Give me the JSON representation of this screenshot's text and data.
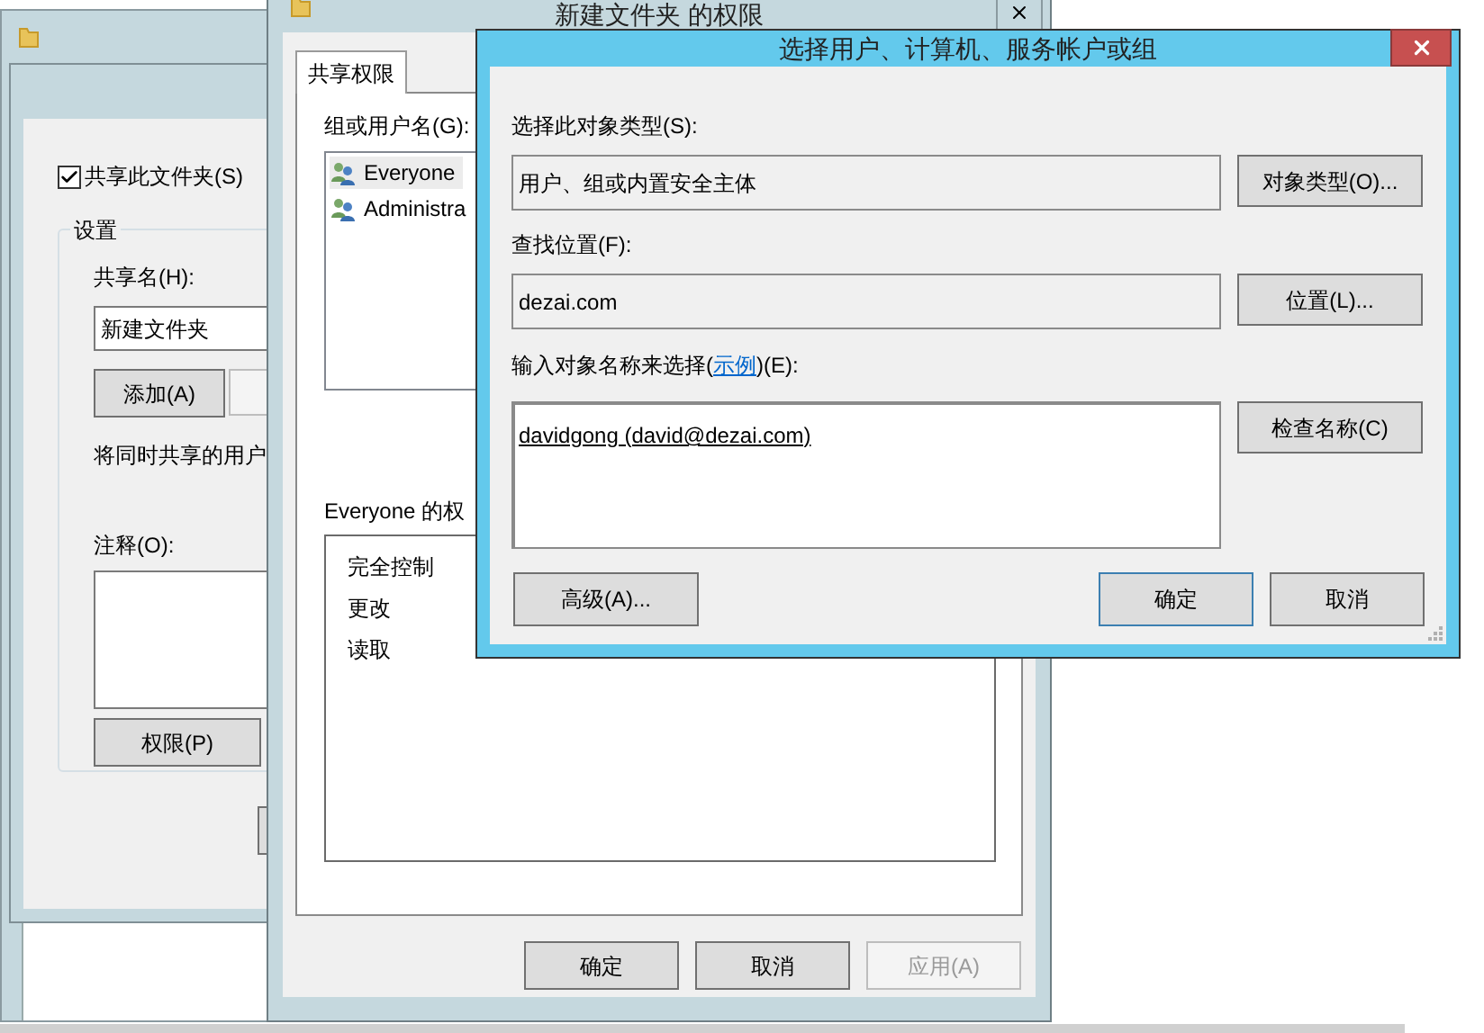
{
  "sharing_window": {
    "share_checkbox": {
      "label": "共享此文件夹(S)",
      "checked": true
    },
    "settings_group": "设置",
    "share_name_label": "共享名(H):",
    "share_name_value": "新建文件夹",
    "add_button": "添加(A)",
    "users_note": "将同时共享的用户",
    "comment_label": "注释(O):",
    "permissions_button": "权限(P)"
  },
  "permissions_window": {
    "title": "新建文件夹 的权限",
    "tabs": [
      {
        "label": "共享权限",
        "selected": true
      }
    ],
    "group_label": "组或用户名(G):",
    "users": [
      {
        "name": "Everyone",
        "selected": true
      },
      {
        "name": "Administra",
        "selected": false
      }
    ],
    "permissions_label": "Everyone 的权",
    "permissions": [
      "完全控制",
      "更改",
      "读取"
    ],
    "buttons": [
      {
        "label": "确定",
        "disabled": false
      },
      {
        "label": "取消",
        "disabled": false
      },
      {
        "label": "应用(A)",
        "disabled": true
      }
    ]
  },
  "select_dialog": {
    "title": "选择用户、计算机、服务帐户或组",
    "object_type_label": "选择此对象类型(S):",
    "object_type_value": "用户、组或内置安全主体",
    "object_type_button": "对象类型(O)...",
    "location_label": "查找位置(F):",
    "location_value": "dezai.com",
    "location_button": "位置(L)...",
    "names_label_before": "输入对象名称来选择(",
    "names_label_link": "示例",
    "names_label_after": ")(E):",
    "names_value": "davidgong (david@dezai.com)",
    "check_names_button": "检查名称(C)",
    "advanced_button": "高级(A)...",
    "buttons": [
      {
        "label": "确定",
        "default": true
      },
      {
        "label": "取消",
        "default": false
      }
    ]
  }
}
